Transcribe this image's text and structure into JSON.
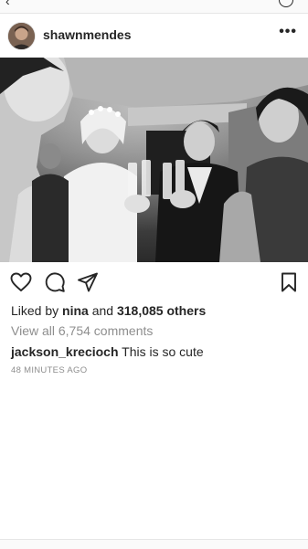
{
  "post": {
    "username": "shawnmendes",
    "more_label": "•••"
  },
  "likes": {
    "prefix": "Liked by",
    "liker": "nina",
    "middle": "and",
    "count": "318,085 others"
  },
  "comments": {
    "view_all": "View all 6,754 comments",
    "items": [
      {
        "user": "jackson_krecioch",
        "text": "This is so cute"
      }
    ]
  },
  "timestamp": "48 MINUTES AGO",
  "icons": {
    "like": "heart-icon",
    "comment": "comment-icon",
    "share": "send-icon",
    "save": "bookmark-icon",
    "back": "chevron-left-icon"
  },
  "colors": {
    "text": "#262626",
    "muted": "#8e8e8e",
    "divider": "#e6e6e6"
  }
}
